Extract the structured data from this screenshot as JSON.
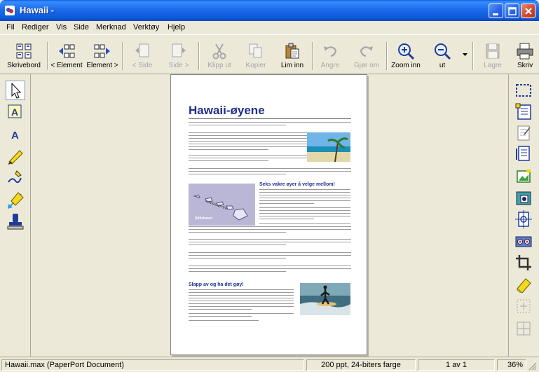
{
  "window": {
    "title": "Hawaii -"
  },
  "menu": [
    "Fil",
    "Rediger",
    "Vis",
    "Side",
    "Merknad",
    "Verktøy",
    "Hjelp"
  ],
  "toolbar": {
    "skrivebord": "Skrivebord",
    "prev_element": "< Element",
    "next_element": "Element >",
    "prev_side": "< Side",
    "next_side": "Side >",
    "klipp_ut": "Klipp ut",
    "kopier": "Kopier",
    "lim_inn": "Lim inn",
    "angre": "Angre",
    "gjor_om": "Gjør om",
    "zoom_inn": "Zoom inn",
    "zoom_ut": "ut",
    "lagre": "Lagre",
    "skriv": "Skriv"
  },
  "document": {
    "title": "Hawaii-øyene",
    "map_label_1": "HAWAII-ØYER",
    "map_label_2": "Stillehavet",
    "heading_1": "Seks vakre øyer å velge mellom!",
    "heading_2": "Slapp av og ha det gøy!"
  },
  "status": {
    "file": "Hawaii.max (PaperPort Document)",
    "resolution": "200 ppt, 24-biters farge",
    "page": "1 av 1",
    "zoom": "36%"
  },
  "colors": {
    "title_blue": "#1E2F8C",
    "xp_title_bar": "#0B57D8"
  }
}
